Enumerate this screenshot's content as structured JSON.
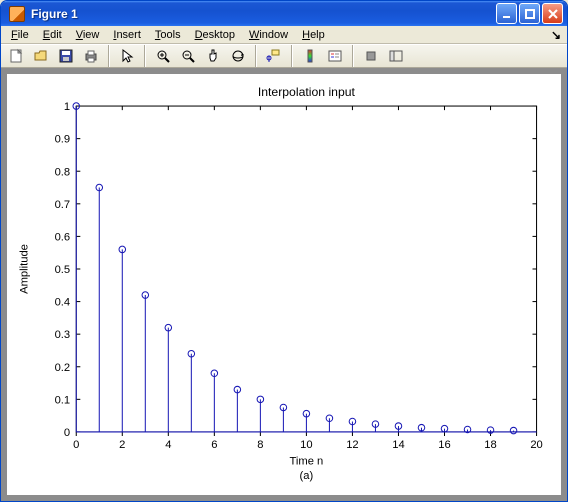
{
  "window": {
    "title": "Figure 1",
    "minimize": "Minimize",
    "maximize": "Maximize",
    "close": "Close"
  },
  "menus": {
    "file": "File",
    "edit": "Edit",
    "view": "View",
    "insert": "Insert",
    "tools": "Tools",
    "desktop": "Desktop",
    "window": "Window",
    "help": "Help",
    "end_glyph": "↘"
  },
  "toolbar_icons": {
    "new": "new-figure-icon",
    "open": "open-icon",
    "save": "save-icon",
    "print": "print-icon",
    "pointer": "pointer-icon",
    "zoomin": "zoom-in-icon",
    "zoomout": "zoom-out-icon",
    "pan": "pan-icon",
    "rotate": "rotate3d-icon",
    "datacursor": "data-cursor-icon",
    "colorbar": "insert-colorbar-icon",
    "legend": "insert-legend-icon",
    "hide": "hide-plot-tools-icon",
    "show": "show-plot-tools-icon"
  },
  "chart_data": {
    "type": "stem",
    "title": "Interpolation input",
    "xlabel": "Time n",
    "sub_xlabel": "(a)",
    "ylabel": "Amplitude",
    "xlim": [
      0,
      20
    ],
    "ylim": [
      0,
      1
    ],
    "xticks": [
      0,
      2,
      4,
      6,
      8,
      10,
      12,
      14,
      16,
      18,
      20
    ],
    "yticks": [
      0,
      0.1,
      0.2,
      0.3,
      0.4,
      0.5,
      0.6,
      0.7,
      0.8,
      0.9,
      1
    ],
    "x": [
      0,
      1,
      2,
      3,
      4,
      5,
      6,
      7,
      8,
      9,
      10,
      11,
      12,
      13,
      14,
      15,
      16,
      17,
      18,
      19
    ],
    "y": [
      1.0,
      0.75,
      0.56,
      0.42,
      0.32,
      0.24,
      0.18,
      0.13,
      0.1,
      0.075,
      0.056,
      0.042,
      0.032,
      0.024,
      0.018,
      0.013,
      0.01,
      0.0075,
      0.0056,
      0.0042
    ],
    "marker_color": "#1818b5",
    "line_color": "#1818b5"
  }
}
